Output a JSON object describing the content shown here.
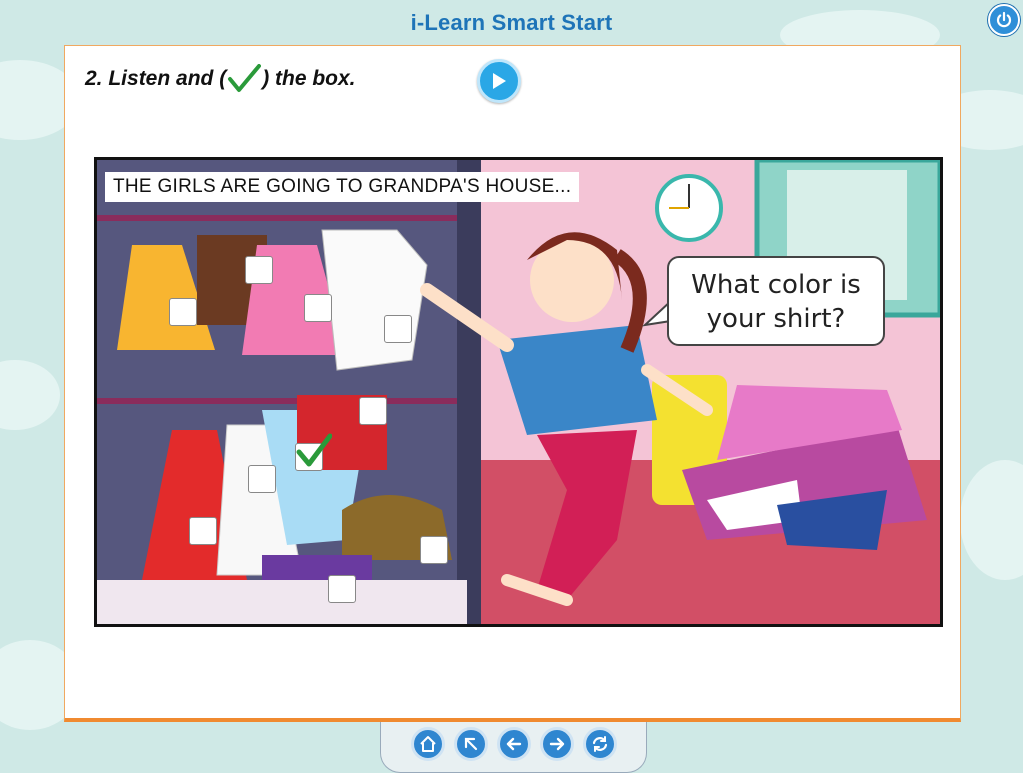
{
  "app": {
    "title": "i-Learn Smart Start"
  },
  "question": {
    "prefix": "2. Listen and (",
    "suffix": ") the box."
  },
  "scene": {
    "caption": "THE GIRLS ARE GOING TO GRANDPA'S HOUSE...",
    "speech_line1": "What color is",
    "speech_line2": "your shirt?"
  },
  "answer_boxes": [
    {
      "id": "yellow-skirt",
      "checked": false
    },
    {
      "id": "brown-shorts",
      "checked": false
    },
    {
      "id": "pink-skirt",
      "checked": false
    },
    {
      "id": "white-shirt",
      "checked": false
    },
    {
      "id": "red-shorts",
      "checked": false
    },
    {
      "id": "blue-shirt",
      "checked": true
    },
    {
      "id": "white-dress",
      "checked": false
    },
    {
      "id": "red-dress",
      "checked": false
    },
    {
      "id": "brown-bag",
      "checked": false
    },
    {
      "id": "purple-pants",
      "checked": false
    }
  ],
  "colors": {
    "accent": "#2f86d0",
    "panel_border": "#f08a30",
    "check": "#2a9a3a"
  },
  "nav": [
    "home-icon",
    "expand-icon",
    "back-arrow-icon",
    "next-arrow-icon",
    "refresh-icon"
  ]
}
